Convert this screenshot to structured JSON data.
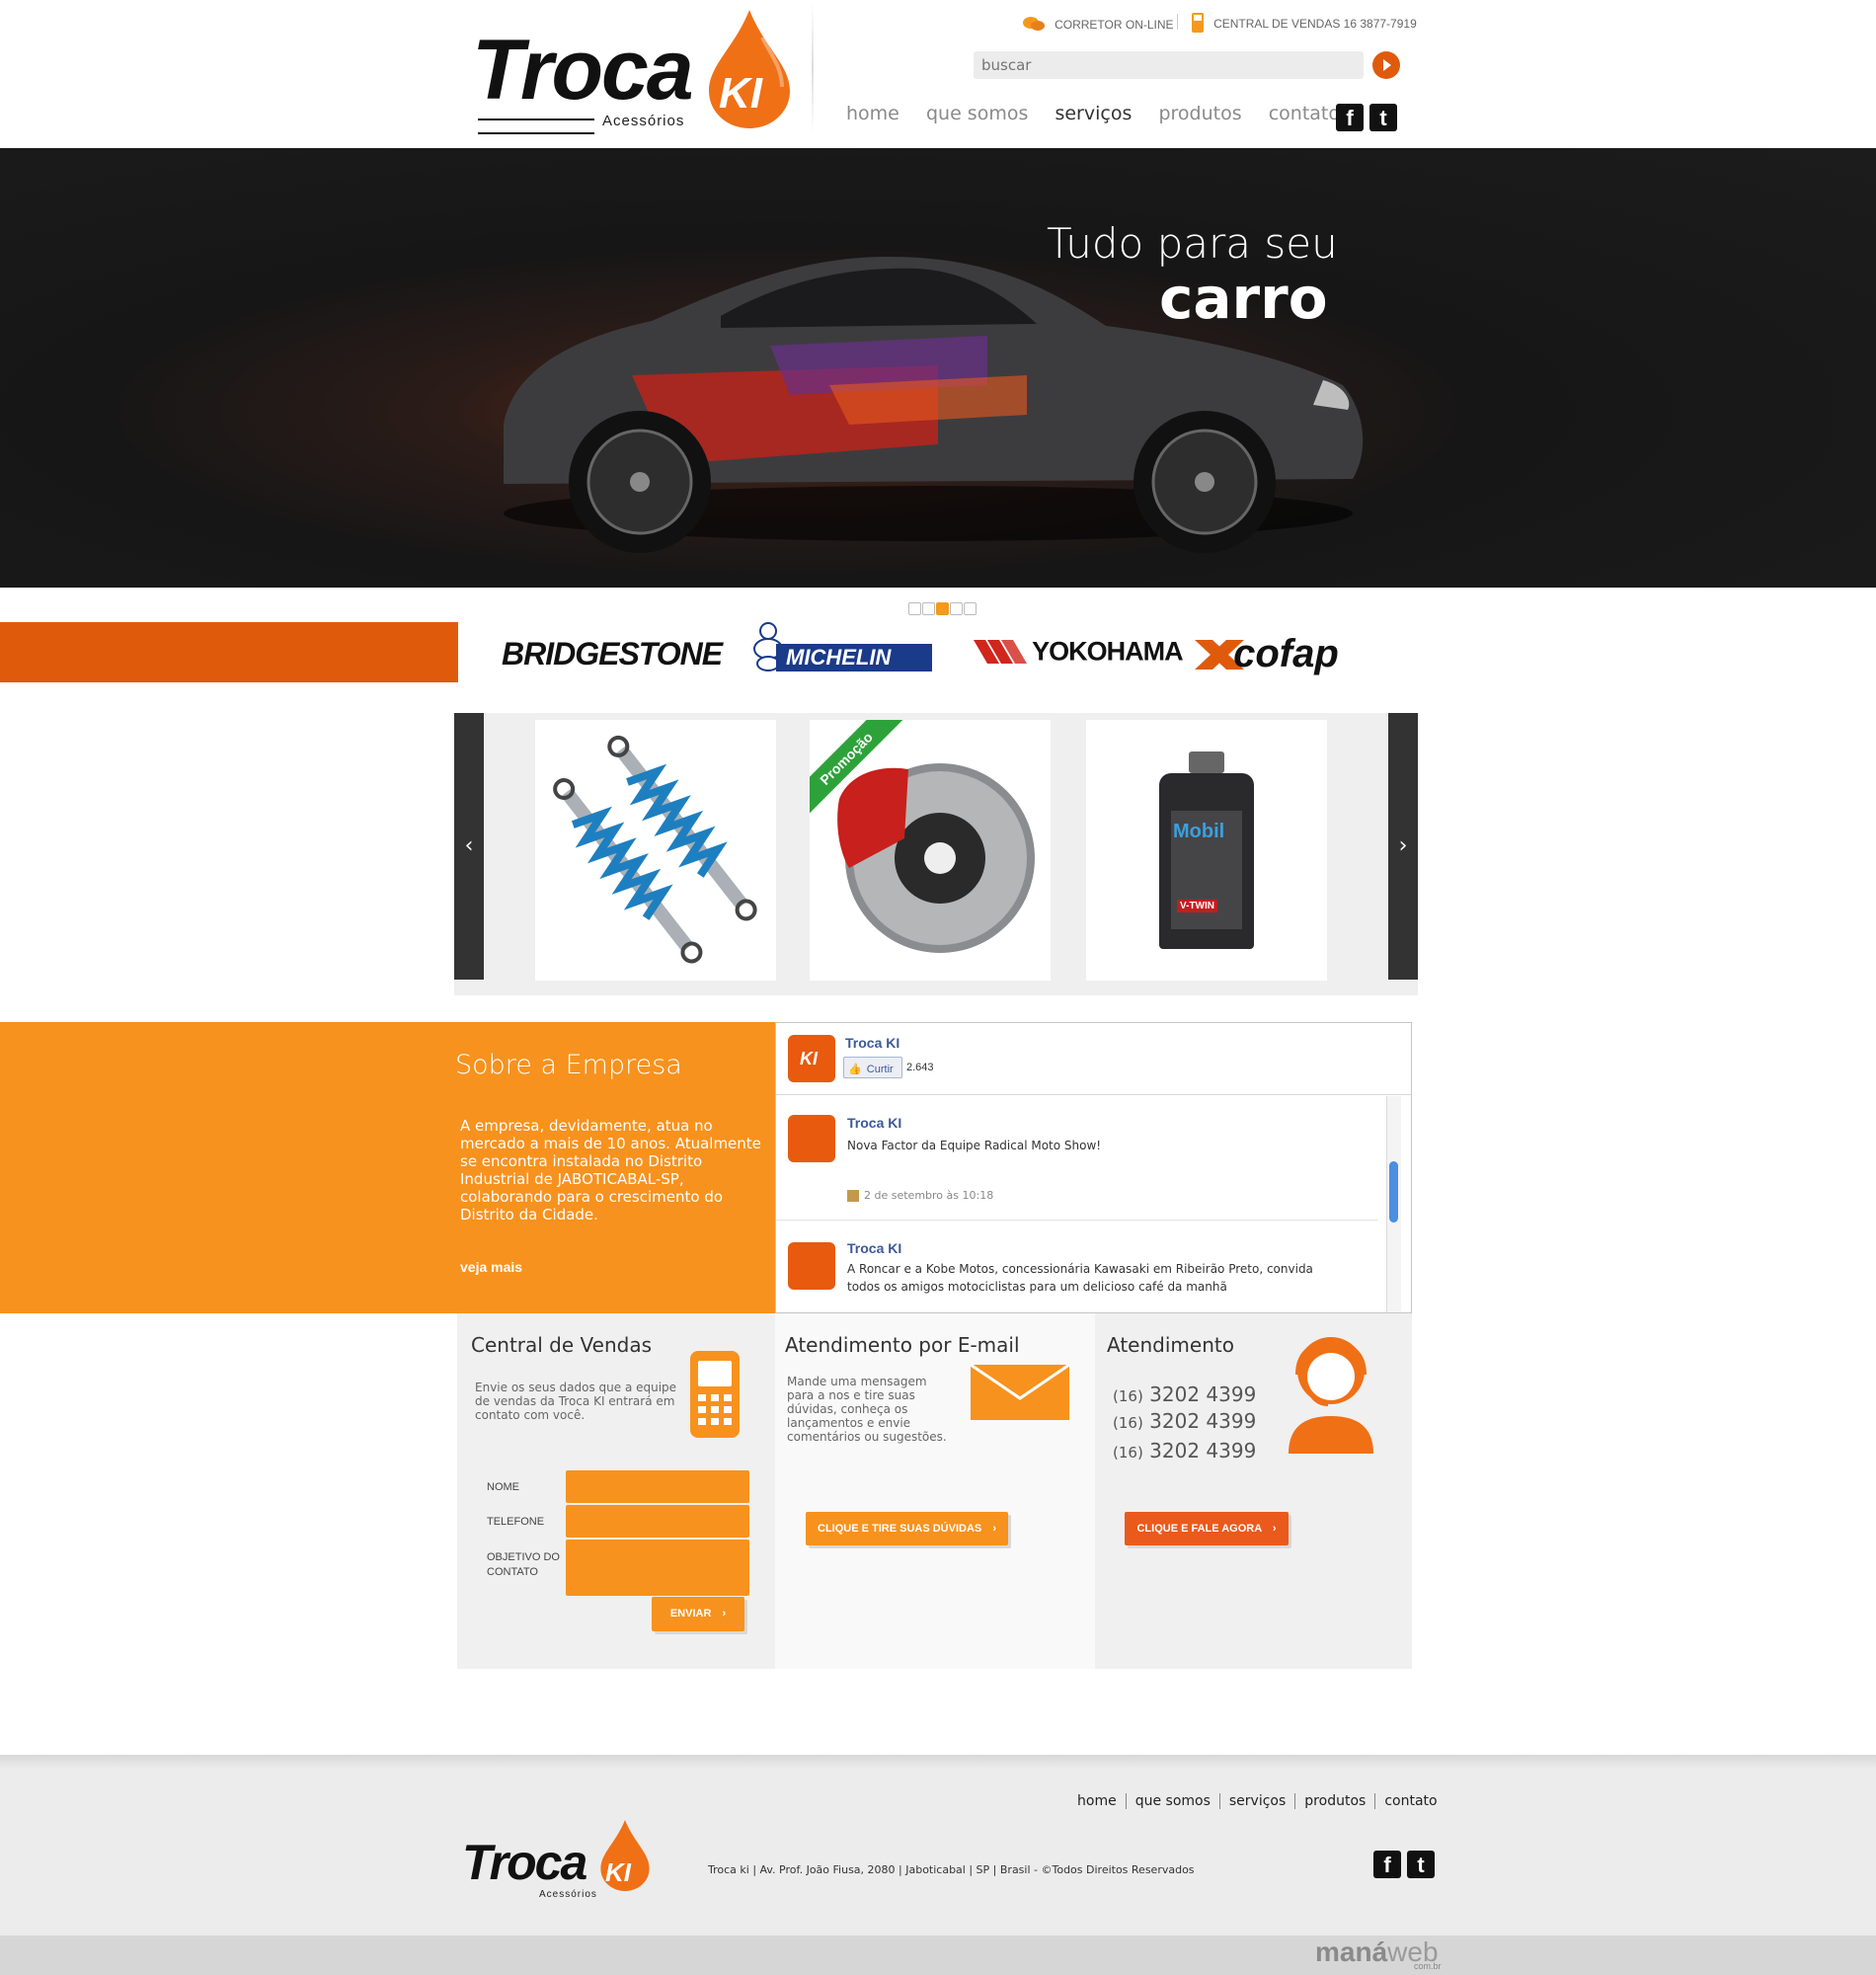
{
  "header": {
    "logo_word": "Troca",
    "logo_ki": "KI",
    "logo_sub": "Acessórios",
    "corretor_label": "CORRETOR ON-LINE",
    "central_label": "CENTRAL DE VENDAS 16 3877-7919",
    "search_placeholder": "buscar",
    "nav": [
      "home",
      "que somos",
      "serviços",
      "produtos",
      "contato"
    ],
    "nav_active": "serviços",
    "social": [
      "facebook-icon",
      "twitter-icon"
    ]
  },
  "hero": {
    "title_line1": "Tudo para seu",
    "title_line2": "carro",
    "slides": 5,
    "active_slide": 3
  },
  "brands": [
    "BRIDGESTONE",
    "MICHELIN",
    "YOKOHAMA",
    "cofap"
  ],
  "products": {
    "items": [
      "shock-absorbers",
      "brake-disc",
      "motor-oil"
    ],
    "promo_label": "Promoção",
    "oil_brand": "Mobil",
    "oil_label": "V-TWIN"
  },
  "about": {
    "title": "Sobre a Empresa",
    "text": "A empresa, devidamente, atua no mercado a mais de 10 anos. Atualmente se encontra instalada no Distrito Industrial de JABOTICABAL-SP, colaborando para o crescimento do Distrito da Cidade.",
    "more": "veja mais"
  },
  "facebook": {
    "page_name": "Troca KI",
    "like_label": "Curtir",
    "like_count": "2.643",
    "posts": [
      {
        "author": "Troca KI",
        "text": "Nova Factor da Equipe Radical Moto Show!",
        "time": "2 de setembro às 10:18"
      },
      {
        "author": "Troca KI",
        "text": "A Roncar e a Kobe Motos, concessionária Kawasaki em Ribeirão Preto, convida todos os amigos motociclistas para um delicioso café da manhã",
        "time": ""
      }
    ]
  },
  "vendas": {
    "title": "Central de Vendas",
    "text": "Envie os seus dados que a equipe de vendas da Troca KI  entrará em contato com você.",
    "label_nome": "NOME",
    "label_telefone": "TELEFONE",
    "label_objetivo": "OBJETIVO DO CONTATO",
    "submit": "ENVIAR"
  },
  "email": {
    "title": "Atendimento por E-mail",
    "text": "Mande uma mensagem para a nos e tire suas dúvidas, conheça os lançamentos e envie comentários ou sugestões.",
    "button": "CLIQUE E TIRE SUAS DÚVIDAS"
  },
  "atendimento": {
    "title": "Atendimento",
    "ddd": "(16)",
    "phones": [
      "3202 4399",
      "3202 4399",
      "3202 4399"
    ],
    "button": "CLIQUE E FALE AGORA"
  },
  "footer": {
    "nav": [
      "home",
      "que somos",
      "serviços",
      "produtos",
      "contato"
    ],
    "address": "Troca ki | Av. Prof. João Fiusa, 2080 | Jaboticabal | SP | Brasil - ©Todos Direitos Reservados",
    "credit_main": "maná",
    "credit_web": "web",
    "credit_sub": "com.br"
  },
  "colors": {
    "accent_orange": "#f7921e",
    "accent_red": "#ea5a1c",
    "brand_bar": "#e05a0c"
  }
}
